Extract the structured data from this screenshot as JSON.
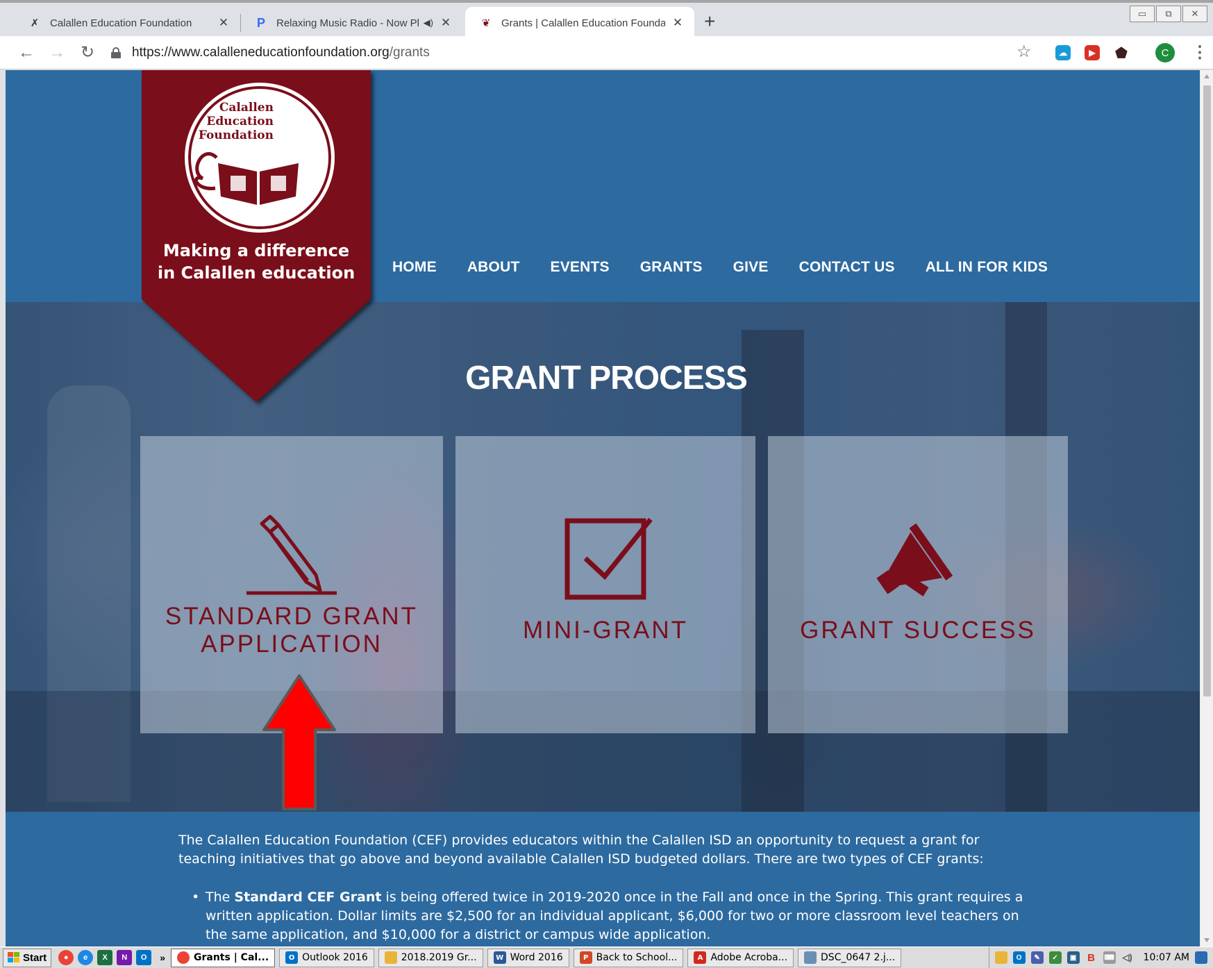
{
  "browser": {
    "tabs": [
      {
        "title": "Calallen Education Foundation",
        "icon": "bookmark-logo-icon",
        "active": false
      },
      {
        "title": "Relaxing Music Radio - Now Pla",
        "icon": "pandora-icon",
        "active": false,
        "audio": "speaker-icon"
      },
      {
        "title": "Grants | Calallen Education Foundat",
        "icon": "cef-favicon-icon",
        "active": true
      }
    ],
    "close_glyph": "✕",
    "new_tab_glyph": "+",
    "address": {
      "host": "https://www.calalleneducationfoundation.org",
      "path": "/grants"
    },
    "profile_initial": "C"
  },
  "site": {
    "logo_lines": [
      "Calallen",
      "Education",
      "Foundation"
    ],
    "tagline_line1": "Making a difference",
    "tagline_line2": "in Calallen education",
    "nav": [
      "HOME",
      "ABOUT",
      "EVENTS",
      "GRANTS",
      "GIVE",
      "CONTACT US",
      "ALL IN FOR KIDS"
    ],
    "hero_title": "GRANT PROCESS",
    "cards": [
      {
        "label_line1": "STANDARD GRANT",
        "label_line2": "APPLICATION",
        "icon": "pencil-icon"
      },
      {
        "label_line1": "MINI-GRANT",
        "icon": "checkbox-icon"
      },
      {
        "label_line1": "GRANT SUCCESS",
        "icon": "megaphone-icon"
      }
    ],
    "intro": "The Calallen Education Foundation (CEF) provides educators within the Calallen ISD an opportunity to request a grant for teaching initiatives that go above and beyond available Calallen ISD budgeted dollars.  There are two types of CEF grants:",
    "bullet_lead": "The ",
    "bullet_bold": "Standard CEF Grant",
    "bullet_rest": " is being offered twice in 2019-2020 once in the Fall and once in the Spring.  This grant requires a written application.  Dollar limits are $2,500 for an individual applicant, $6,000 for two or more classroom level teachers on the same application, and $10,000 for a district or campus wide application."
  },
  "colors": {
    "maroon": "#7a0e1a",
    "page_blue": "#2d6aa0",
    "annotation_arrow": "#ff0000"
  },
  "taskbar": {
    "start_label": "Start",
    "overflow_glyph": "»",
    "items": [
      {
        "label": "Grants | Cal...",
        "active": true,
        "icon": "chrome-icon"
      },
      {
        "label": "Outlook 2016",
        "icon": "outlook-icon"
      },
      {
        "label": "2018.2019 Gr...",
        "icon": "folder-icon"
      },
      {
        "label": "Word 2016",
        "icon": "word-icon"
      },
      {
        "label": "Back to School...",
        "icon": "powerpoint-icon"
      },
      {
        "label": "Adobe Acroba...",
        "icon": "acrobat-icon"
      },
      {
        "label": "DSC_0647 2.j...",
        "icon": "image-viewer-icon"
      }
    ],
    "clock": "10:07 AM"
  }
}
